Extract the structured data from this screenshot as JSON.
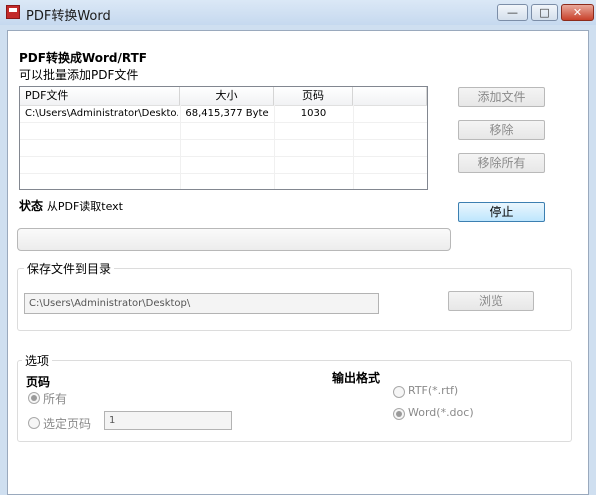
{
  "window": {
    "title": "PDF转换Word",
    "minimize": "—",
    "maximize": "□",
    "close": "✕"
  },
  "heading": {
    "title": "PDF转换成Word/RTF",
    "subtitle": "可以批量添加PDF文件"
  },
  "file_list": {
    "columns": [
      "PDF文件",
      "大小",
      "页码"
    ],
    "rows": [
      {
        "file": "C:\\Users\\Administrator\\Deskto...",
        "size": "68,415,377 Byte",
        "pages": "1030"
      }
    ]
  },
  "buttons": {
    "add_file": "添加文件",
    "remove": "移除",
    "remove_all": "移除所有",
    "stop": "停止",
    "browse": "浏览"
  },
  "status": {
    "label": "状态",
    "text": "从PDF读取text",
    "progress": 0
  },
  "save_dir": {
    "legend": "保存文件到目录",
    "path": "C:\\Users\\Administrator\\Desktop\\"
  },
  "options": {
    "legend": "选项",
    "pages_label": "页码",
    "all_pages": "所有",
    "selected_pages": "选定页码",
    "selected_pages_value": "1",
    "output_label": "输出格式",
    "rtf": "RTF(*.rtf)",
    "word": "Word(*.doc)"
  }
}
